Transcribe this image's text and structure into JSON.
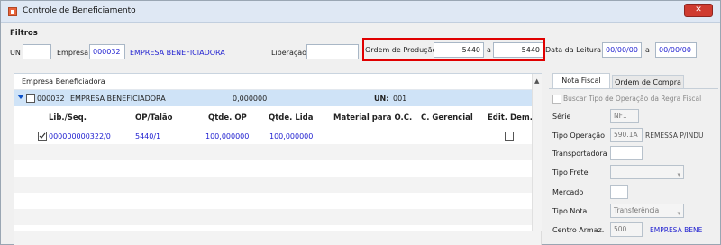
{
  "window": {
    "title": "Controle de Beneficiamento",
    "close_glyph": "✕"
  },
  "filters": {
    "title": "Filtros",
    "un_label": "UN",
    "un_value": "",
    "empresa_label": "Empresa",
    "empresa_code": "000032",
    "empresa_name": "EMPRESA BENEFICIADORA",
    "liberacao_label": "Liberação",
    "liberacao_value": "",
    "ordem_label": "Ordem de Produção",
    "ordem_from": "5440",
    "a_label": "a",
    "ordem_to": "5440",
    "data_label": "Data da Leitura",
    "data_from": "00/00/00",
    "data_to": "00/00/00"
  },
  "grid": {
    "header": "Empresa Beneficiadora",
    "group": {
      "code": "000032",
      "name": "EMPRESA BENEFICIADORA",
      "value": "0,000000",
      "un_label": "UN:",
      "un_value": "001"
    },
    "columns": [
      "Lib./Seq.",
      "OP/Talão",
      "Qtde. OP",
      "Qtde. Lida",
      "Material para O.C.",
      "C. Gerencial",
      "Edit. Dem."
    ],
    "rows": [
      {
        "seq": "000000000322/0",
        "op": "5440/1",
        "qtde_op": "100,000000",
        "qtde_lida": "100,000000",
        "material": "",
        "gerencial": "",
        "checked": true,
        "edit_dem": false
      }
    ]
  },
  "side_panel": {
    "tabs": [
      "Nota Fiscal",
      "Ordem de Compra"
    ],
    "active_tab": "Nota Fiscal",
    "buscar_label": "Buscar Tipo de Operação da Regra Fiscal",
    "serie_label": "Série",
    "serie_value": "NF1",
    "tipo_operacao_label": "Tipo Operação",
    "tipo_operacao_code": "590.1A",
    "tipo_operacao_desc": "REMESSA P/INDU",
    "transportadora_label": "Transportadora",
    "tipo_frete_label": "Tipo Frete",
    "mercado_label": "Mercado",
    "tipo_nota_label": "Tipo Nota",
    "tipo_nota_value": "Transferência",
    "centro_label": "Centro Armaz.",
    "centro_code": "500",
    "centro_name": "EMPRESA BENE"
  },
  "colors": {
    "highlight": "#e00000",
    "selected_row": "#cfe3f7",
    "link_text": "#1f1fd0",
    "close_button": "#cf3b30"
  }
}
